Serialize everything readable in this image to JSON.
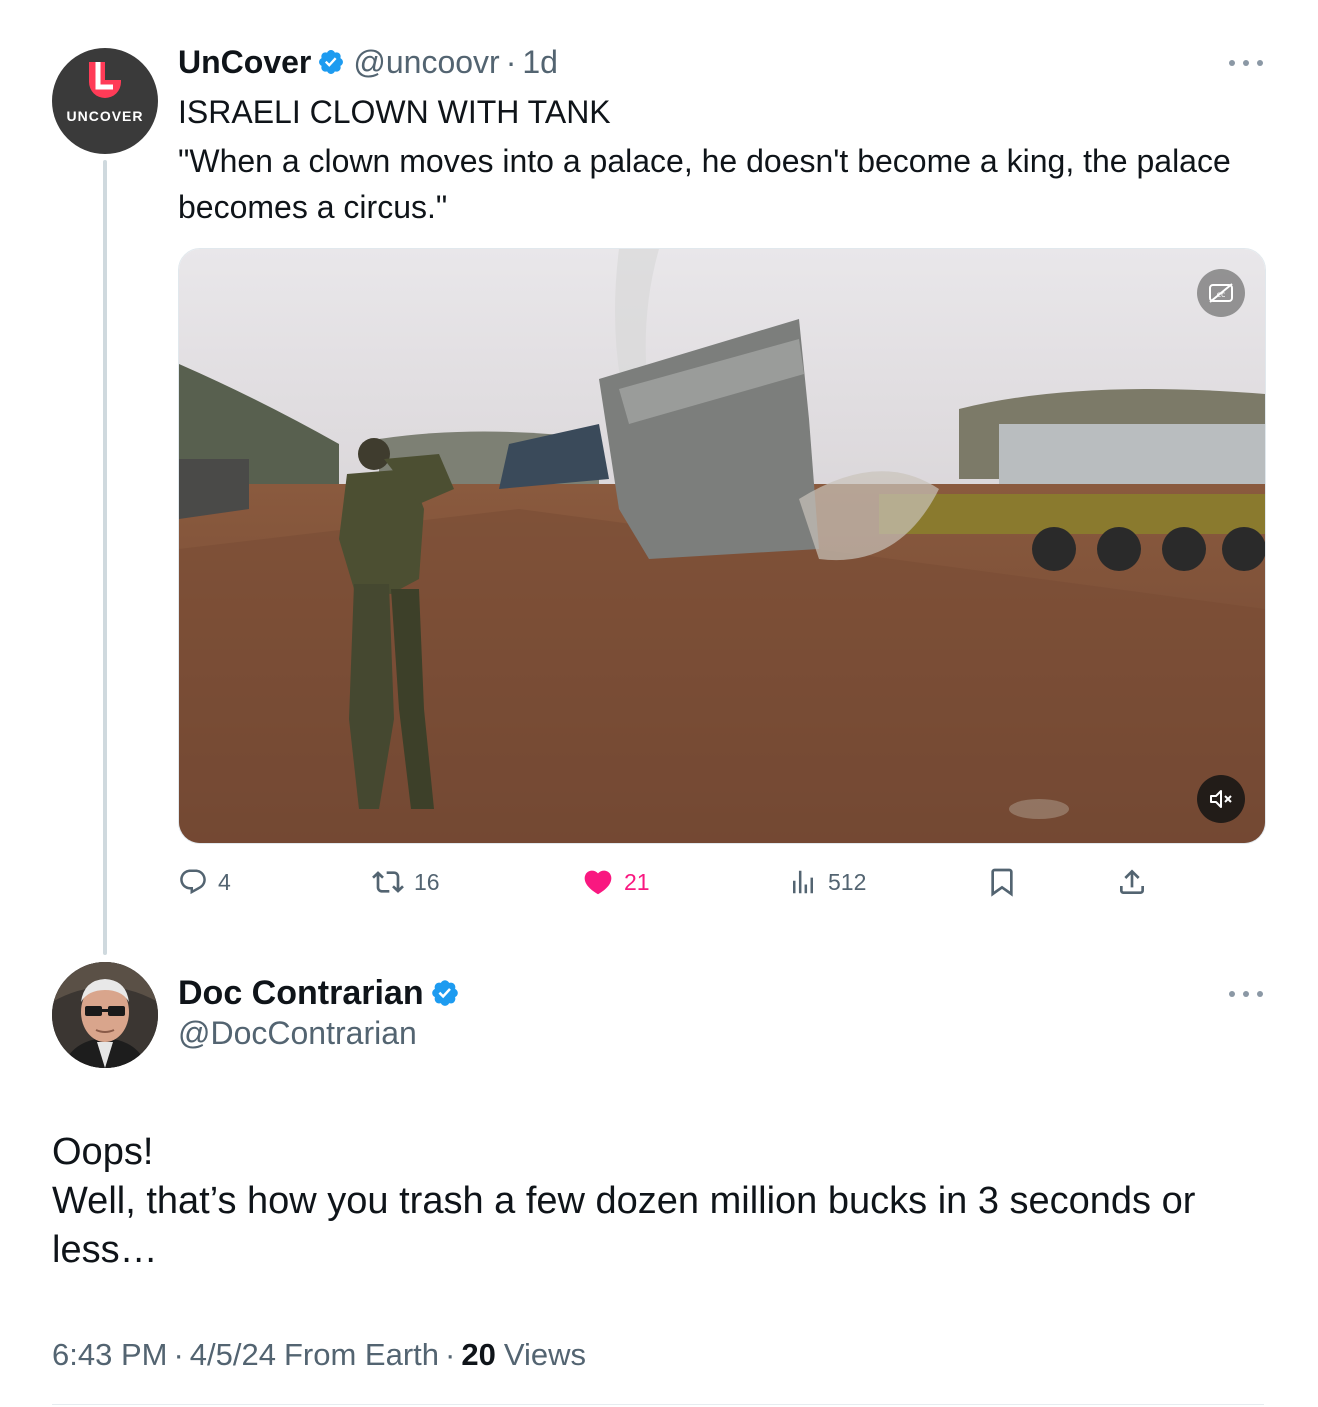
{
  "theme": {
    "accent": "#1d9bf0",
    "like_color": "#f91880",
    "secondary_text": "#536471",
    "primary_text": "#0f1419"
  },
  "tweet1": {
    "avatar_text": "UNCOVER",
    "display_name": "UnCover",
    "verified": true,
    "handle": "@uncoovr",
    "separator": "·",
    "time": "1d",
    "more_icon": "more-icon",
    "title": "ISRAELI CLOWN WITH TANK",
    "quote": "\"When a clown moves into a palace, he doesn't become a king, the palace becomes a circus.\"",
    "media": {
      "type": "video",
      "captions_icon": "captions-off-icon",
      "mute_icon": "muted-speaker-icon"
    },
    "actions": {
      "replies": "4",
      "reposts": "16",
      "likes": "21",
      "liked": true,
      "views": "512",
      "bookmark_icon": "bookmark-icon",
      "share_icon": "share-icon"
    }
  },
  "tweet2": {
    "display_name": "Doc Contrarian",
    "verified": true,
    "handle": "@DocContrarian",
    "more_icon": "more-icon",
    "body_lines": [
      "Oops!",
      "Well, that’s how you trash a few dozen million bucks in 3 seconds or",
      "less…"
    ],
    "meta": {
      "time": "6:43 PM",
      "sep1": "·",
      "date": "4/5/24",
      "source": "From Earth",
      "sep2": "·",
      "views_count": "20",
      "views_label": "Views"
    }
  }
}
